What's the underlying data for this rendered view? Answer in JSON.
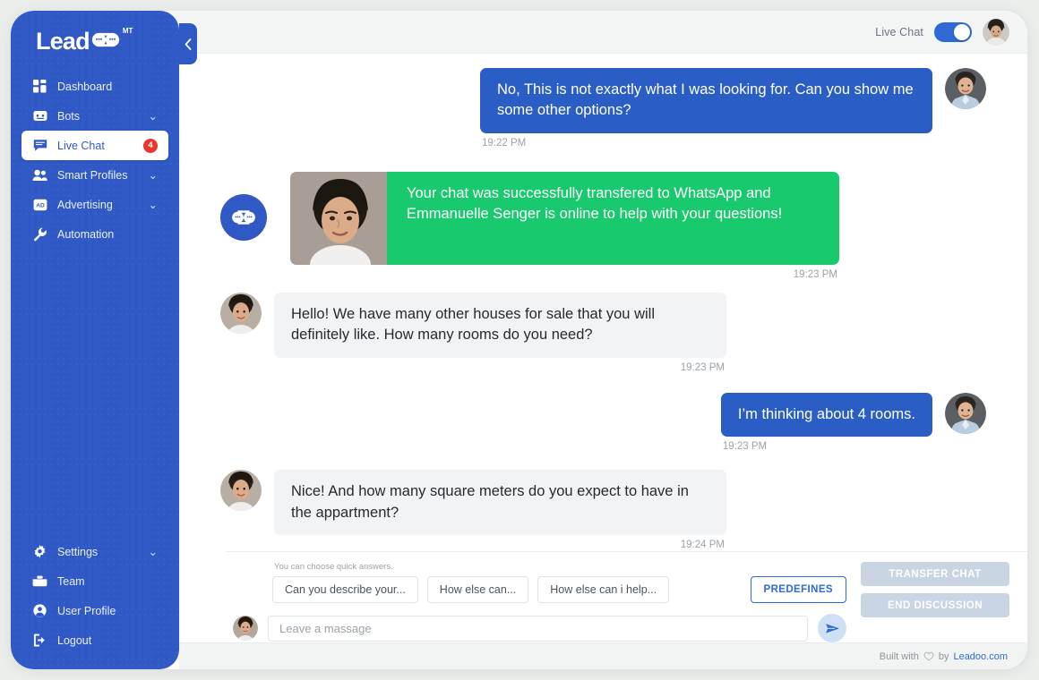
{
  "brand": {
    "name": "Leadoo",
    "superscript": "MT",
    "accent_blue": "#3059c6",
    "bubble_blue": "#2b5ec4",
    "bubble_green": "#18c96e",
    "badge_red": "#e8372c"
  },
  "sidebar": {
    "collapse_icon": "chevron-left-icon",
    "items": [
      {
        "label": "Dashboard",
        "icon": "dashboard-icon",
        "chevron": "",
        "badge": "",
        "active": false
      },
      {
        "label": "Bots",
        "icon": "bot-icon",
        "chevron": "⌄",
        "badge": "",
        "active": false
      },
      {
        "label": "Live Chat",
        "icon": "chat-icon",
        "chevron": "",
        "badge": "4",
        "active": true
      },
      {
        "label": "Smart Profiles",
        "icon": "people-icon",
        "chevron": "⌄",
        "badge": "",
        "active": false
      },
      {
        "label": "Advertising",
        "icon": "ad-icon",
        "chevron": "⌄",
        "badge": "",
        "active": false
      },
      {
        "label": "Automation",
        "icon": "wrench-icon",
        "chevron": "",
        "badge": "",
        "active": false
      }
    ],
    "bottom_items": [
      {
        "label": "Settings",
        "icon": "gear-icon",
        "chevron": "⌄"
      },
      {
        "label": "Team",
        "icon": "team-icon",
        "chevron": ""
      },
      {
        "label": "User Profile",
        "icon": "user-icon",
        "chevron": ""
      },
      {
        "label": "Logout",
        "icon": "logout-icon",
        "chevron": ""
      }
    ]
  },
  "header": {
    "live_chat_label": "Live Chat",
    "toggle_on": true,
    "avatar_name": "avatar"
  },
  "messages": [
    {
      "id": "m1",
      "side": "right",
      "style": "blue",
      "text": "No, This is not exactly what I was looking for. Can you show me some other options?",
      "time": "19:22 PM",
      "time_align": "left",
      "avatar": "visitor"
    },
    {
      "id": "m2",
      "side": "left",
      "style": "green",
      "text": "Your chat was successfully transfered to WhatsApp and Emmanuelle Senger is online to help with your questions!",
      "time": "19:23 PM",
      "time_align": "right",
      "avatar": "bot-badge",
      "has_photo": true
    },
    {
      "id": "m3",
      "side": "left",
      "style": "grey",
      "text": "Hello! We have many other houses for sale that you will definitely like. How many rooms do you need?",
      "time": "19:23 PM",
      "time_align": "right",
      "avatar": "agent"
    },
    {
      "id": "m4",
      "side": "right",
      "style": "blue",
      "text": "I’m thinking about 4 rooms.",
      "time": "19:23 PM",
      "time_align": "left",
      "avatar": "visitor"
    },
    {
      "id": "m5",
      "side": "left",
      "style": "grey",
      "text": "Nice! And how many square meters do you expect to have in the appartment?",
      "time": "19:24 PM",
      "time_align": "right",
      "avatar": "agent"
    }
  ],
  "composer": {
    "quick_answers_label": "You can choose quick answers.",
    "quick_answers": [
      "Can you describe your...",
      "How else can...",
      "How else can i help..."
    ],
    "predefines_label": "PREDEFINES",
    "input_value": "",
    "input_placeholder": "Leave a massage",
    "send_icon": "send-icon",
    "transfer_chat_label": "TRANSFER CHAT",
    "end_discussion_label": "END DISCUSSION"
  },
  "footer": {
    "built_with": "Built with",
    "heart_icon": "heart-icon",
    "by": "by",
    "link": "Leadoo.com"
  }
}
